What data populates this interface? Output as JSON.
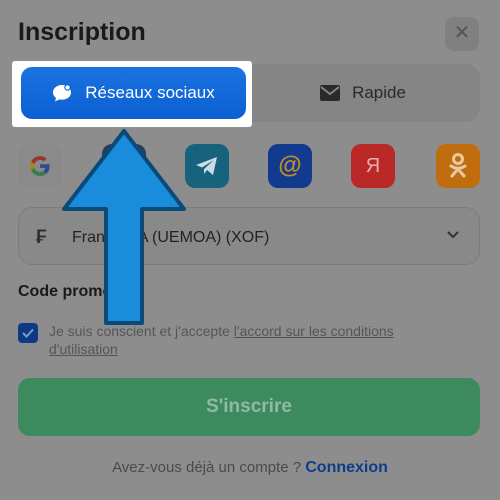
{
  "header": {
    "title": "Inscription",
    "close_glyph": "✕"
  },
  "tabs": [
    {
      "label": "Réseaux sociaux",
      "icon": "chat-bubble-icon",
      "active": true
    },
    {
      "label": "Rapide",
      "icon": "envelope-icon",
      "active": false
    }
  ],
  "social": [
    {
      "name": "google",
      "color": "#e8e8e8"
    },
    {
      "name": "hidden-provider",
      "color": "#2d3b58"
    },
    {
      "name": "telegram",
      "color": "#17637d",
      "glyph": "➤"
    },
    {
      "name": "mail-ru",
      "color": "#123a8f",
      "glyph": "@"
    },
    {
      "name": "yandex",
      "color": "#bb2828",
      "glyph": "Я"
    },
    {
      "name": "odnoklassniki",
      "color": "#bf6d0f",
      "glyph": "ok"
    }
  ],
  "currency": {
    "icon_glyph": "₣",
    "value": "Franc CFA (UEMOA) (XOF)"
  },
  "promo": {
    "label": "Code promo"
  },
  "terms": {
    "prefix": "Je suis conscient et j'accepte ",
    "link": "l'accord sur les conditions d'utilisation",
    "checked": true
  },
  "submit": {
    "label": "S'inscrire"
  },
  "login": {
    "prompt": "Avez-vous déjà un compte ?",
    "link": "Connexion"
  },
  "colors": {
    "accent": "#0b5fd2",
    "arrow": "#1a8cdc",
    "submit": "#3e8a5f"
  }
}
